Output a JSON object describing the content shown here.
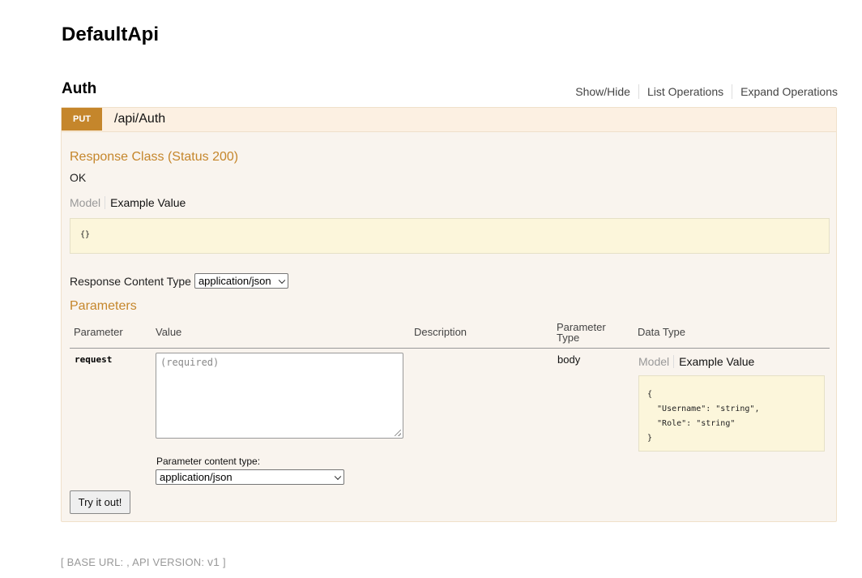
{
  "api": {
    "title": "DefaultApi"
  },
  "resource": {
    "title": "Auth",
    "links": [
      "Show/Hide",
      "List Operations",
      "Expand Operations"
    ]
  },
  "operation": {
    "method": "PUT",
    "path": "/api/Auth",
    "response_class_title": "Response Class (Status 200)",
    "response_text": "OK",
    "model_tabs": {
      "model": "Model",
      "example": "Example Value"
    },
    "response_example": "{}",
    "response_content_type_label": "Response Content Type",
    "response_content_type_value": "application/json",
    "parameters_title": "Parameters",
    "param_headers": {
      "parameter": "Parameter",
      "value": "Value",
      "description": "Description",
      "parameter_type": "Parameter\nType",
      "data_type": "Data Type"
    },
    "params": [
      {
        "name": "request",
        "placeholder": "(required)",
        "param_type": "body",
        "content_type_label": "Parameter content type:",
        "content_type_value": "application/json",
        "example": "{\n  \"Username\": \"string\",\n  \"Role\": \"string\"\n}"
      }
    ],
    "try_button": "Try it out!"
  },
  "footer": {
    "open": "[ ",
    "base_url_label": "BASE URL: ",
    "sep": ", ",
    "api_version_label": "API VERSION: ",
    "api_version": "v1",
    "close": " ]"
  },
  "colors": {
    "accent": "#c5862b",
    "operation_bg": "#f9f4ee",
    "code_bg": "#fcf6db"
  }
}
